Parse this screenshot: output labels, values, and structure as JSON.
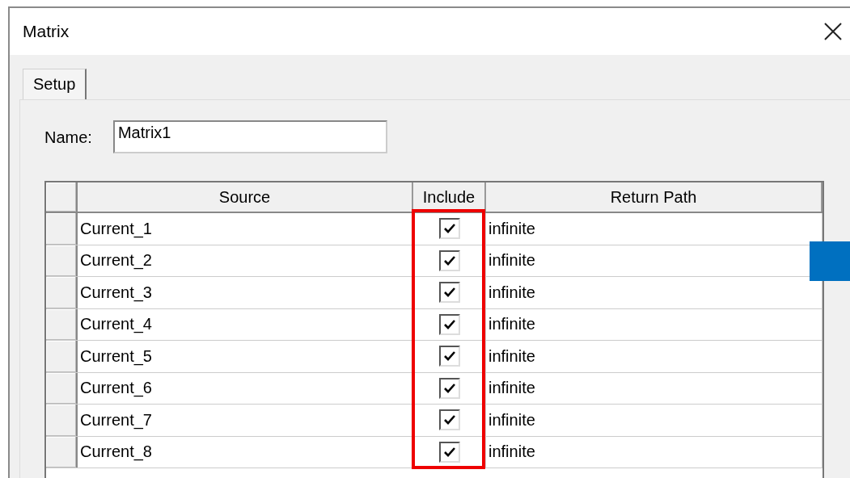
{
  "window": {
    "title": "Matrix"
  },
  "tabs": [
    {
      "label": "Setup",
      "selected": true
    }
  ],
  "name_field": {
    "label": "Name:",
    "value": "Matrix1"
  },
  "table": {
    "columns": [
      "Source",
      "Include",
      "Return Path"
    ],
    "rows": [
      {
        "source": "Current_1",
        "include": true,
        "return_path": "infinite"
      },
      {
        "source": "Current_2",
        "include": true,
        "return_path": "infinite"
      },
      {
        "source": "Current_3",
        "include": true,
        "return_path": "infinite"
      },
      {
        "source": "Current_4",
        "include": true,
        "return_path": "infinite"
      },
      {
        "source": "Current_5",
        "include": true,
        "return_path": "infinite"
      },
      {
        "source": "Current_6",
        "include": true,
        "return_path": "infinite"
      },
      {
        "source": "Current_7",
        "include": true,
        "return_path": "infinite"
      },
      {
        "source": "Current_8",
        "include": true,
        "return_path": "infinite"
      }
    ]
  }
}
